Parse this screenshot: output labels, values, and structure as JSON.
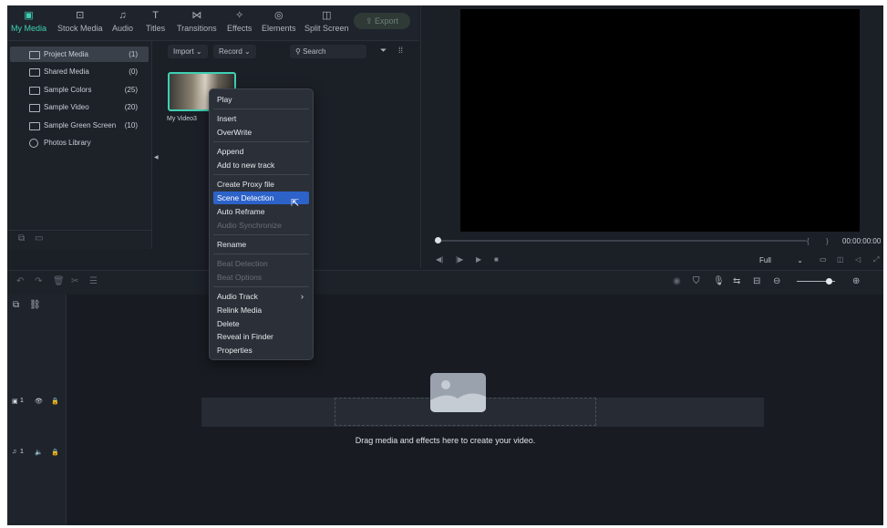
{
  "toolbar": {
    "tabs": [
      {
        "label": "My Media",
        "icon": "▣"
      },
      {
        "label": "Stock Media",
        "icon": "⊡"
      },
      {
        "label": "Audio",
        "icon": "♫"
      },
      {
        "label": "Titles",
        "icon": "T"
      },
      {
        "label": "Transitions",
        "icon": "⋈"
      },
      {
        "label": "Effects",
        "icon": "✧"
      },
      {
        "label": "Elements",
        "icon": "◎"
      },
      {
        "label": "Split Screen",
        "icon": "◫"
      }
    ],
    "export_label": "Export"
  },
  "sidebar": {
    "items": [
      {
        "label": "Project Media",
        "count": "(1)"
      },
      {
        "label": "Shared Media",
        "count": "(0)"
      },
      {
        "label": "Sample Colors",
        "count": "(25)"
      },
      {
        "label": "Sample Video",
        "count": "(20)"
      },
      {
        "label": "Sample Green Screen",
        "count": "(10)"
      },
      {
        "label": "Photos Library",
        "count": ""
      }
    ]
  },
  "media": {
    "import_label": "Import",
    "record_label": "Record",
    "search_placeholder": "Search",
    "clip_name": "My Video3"
  },
  "context_menu": {
    "items": [
      "Play",
      "Insert",
      "OverWrite",
      "Append",
      "Add to new track",
      "Create Proxy file",
      "Scene Detection",
      "Auto Reframe",
      "Audio Synchronize",
      "Rename",
      "Beat Detection",
      "Beat Options",
      "Audio Track",
      "Relink Media",
      "Delete",
      "Reveal in Finder",
      "Properties"
    ]
  },
  "preview": {
    "timecode": "00:00:00:00",
    "zoom": "Full"
  },
  "timeline": {
    "video_track": "1",
    "audio_track": "1",
    "drop_hint": "Drag media and effects here to create your video."
  },
  "colors": {
    "accent": "#3fd0b4",
    "menu_highlight": "#2d62c9"
  }
}
